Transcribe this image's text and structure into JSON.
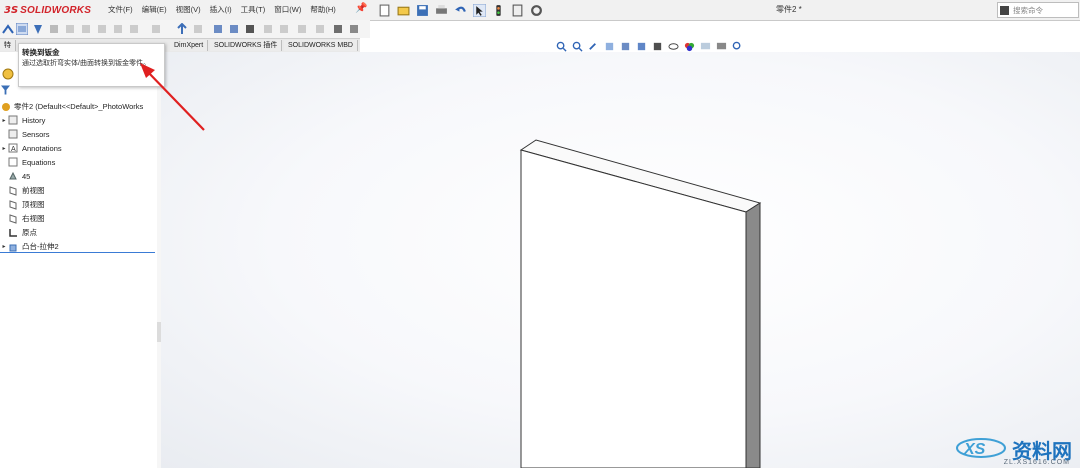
{
  "app": {
    "logo_ds": "3S",
    "logo_name": "SOLIDWORKS"
  },
  "menu": [
    "文件(F)",
    "编辑(E)",
    "视图(V)",
    "插入(I)",
    "工具(T)",
    "窗口(W)",
    "帮助(H)"
  ],
  "document_title": "零件2 *",
  "search": {
    "placeholder": "搜索命令"
  },
  "command_tabs": [
    "特",
    "DimXpert",
    "SOLIDWORKS 插件",
    "SOLIDWORKS MBD"
  ],
  "tooltip": {
    "title": "转换到钣金",
    "description": "通过选取折弯实体/曲面转换到钣金零件。"
  },
  "tree": {
    "root_label": "零件2 (Default<<Default>_PhotoWorks",
    "items": [
      {
        "label": "History",
        "icon": "history-icon",
        "expandable": true
      },
      {
        "label": "Sensors",
        "icon": "sensors-icon",
        "expandable": false
      },
      {
        "label": "Annotations",
        "icon": "annotations-icon",
        "expandable": true
      },
      {
        "label": "Equations",
        "icon": "equations-icon",
        "expandable": false
      },
      {
        "label": "45",
        "icon": "material-icon",
        "expandable": false
      },
      {
        "label": "前视图",
        "icon": "plane-icon",
        "expandable": false
      },
      {
        "label": "顶视图",
        "icon": "plane-icon",
        "expandable": false
      },
      {
        "label": "右视图",
        "icon": "plane-icon",
        "expandable": false
      },
      {
        "label": "原点",
        "icon": "origin-icon",
        "expandable": false
      },
      {
        "label": "凸台-拉伸2",
        "icon": "boss-extrude-icon",
        "expandable": true
      }
    ]
  },
  "watermark": {
    "brand": "资料网",
    "url": "ZL.XS1616.COM"
  },
  "colors": {
    "accent": "#d2232a",
    "selection": "#3a7bd5",
    "annotation_arrow": "#e02020"
  }
}
